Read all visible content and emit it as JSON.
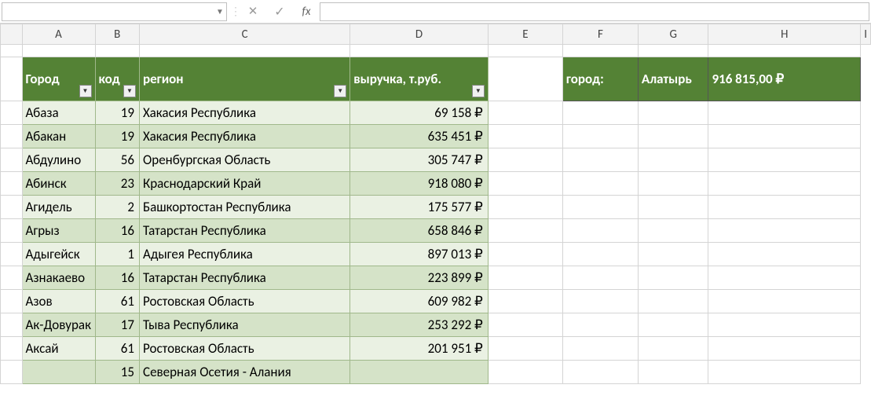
{
  "columns": {
    "A": "A",
    "B": "B",
    "C": "C",
    "D": "D",
    "E": "E",
    "F": "F",
    "G": "G",
    "H": "H",
    "I": "I"
  },
  "table": {
    "headers": {
      "city": "Город",
      "code": "код",
      "region": "регион",
      "revenue": "выручка, т.руб."
    },
    "rows": [
      {
        "city": "Абаза",
        "code": "19",
        "region": "Хакасия Республика",
        "revenue": "69 158 ₽"
      },
      {
        "city": "Абакан",
        "code": "19",
        "region": "Хакасия Республика",
        "revenue": "635 451 ₽"
      },
      {
        "city": "Абдулино",
        "code": "56",
        "region": "Оренбургская Область",
        "revenue": "305 747 ₽"
      },
      {
        "city": "Абинск",
        "code": "23",
        "region": "Краснодарский Край",
        "revenue": "918 080 ₽"
      },
      {
        "city": "Агидель",
        "code": "2",
        "region": "Башкортостан Республика",
        "revenue": "175 577 ₽"
      },
      {
        "city": "Агрыз",
        "code": "16",
        "region": "Татарстан Республика",
        "revenue": "658 846 ₽"
      },
      {
        "city": "Адыгейск",
        "code": "1",
        "region": "Адыгея Республика",
        "revenue": "897 013 ₽"
      },
      {
        "city": "Азнакаево",
        "code": "16",
        "region": "Татарстан Республика",
        "revenue": "223 899 ₽"
      },
      {
        "city": "Азов",
        "code": "61",
        "region": "Ростовская Область",
        "revenue": "609 982 ₽"
      },
      {
        "city": "Ак-Довурак",
        "code": "17",
        "region": "Тыва Республика",
        "revenue": "253 292 ₽"
      },
      {
        "city": "Аксай",
        "code": "61",
        "region": "Ростовская Область",
        "revenue": "201 951 ₽"
      },
      {
        "city": "",
        "code": "15",
        "region": "Северная Осетия - Алания",
        "revenue": ""
      }
    ]
  },
  "formula_bar": {
    "name_box": "",
    "fx_label": "fx",
    "input": ""
  },
  "lookup": {
    "label": "город:",
    "city": "Алатырь",
    "result": "916 815,00 ₽"
  }
}
